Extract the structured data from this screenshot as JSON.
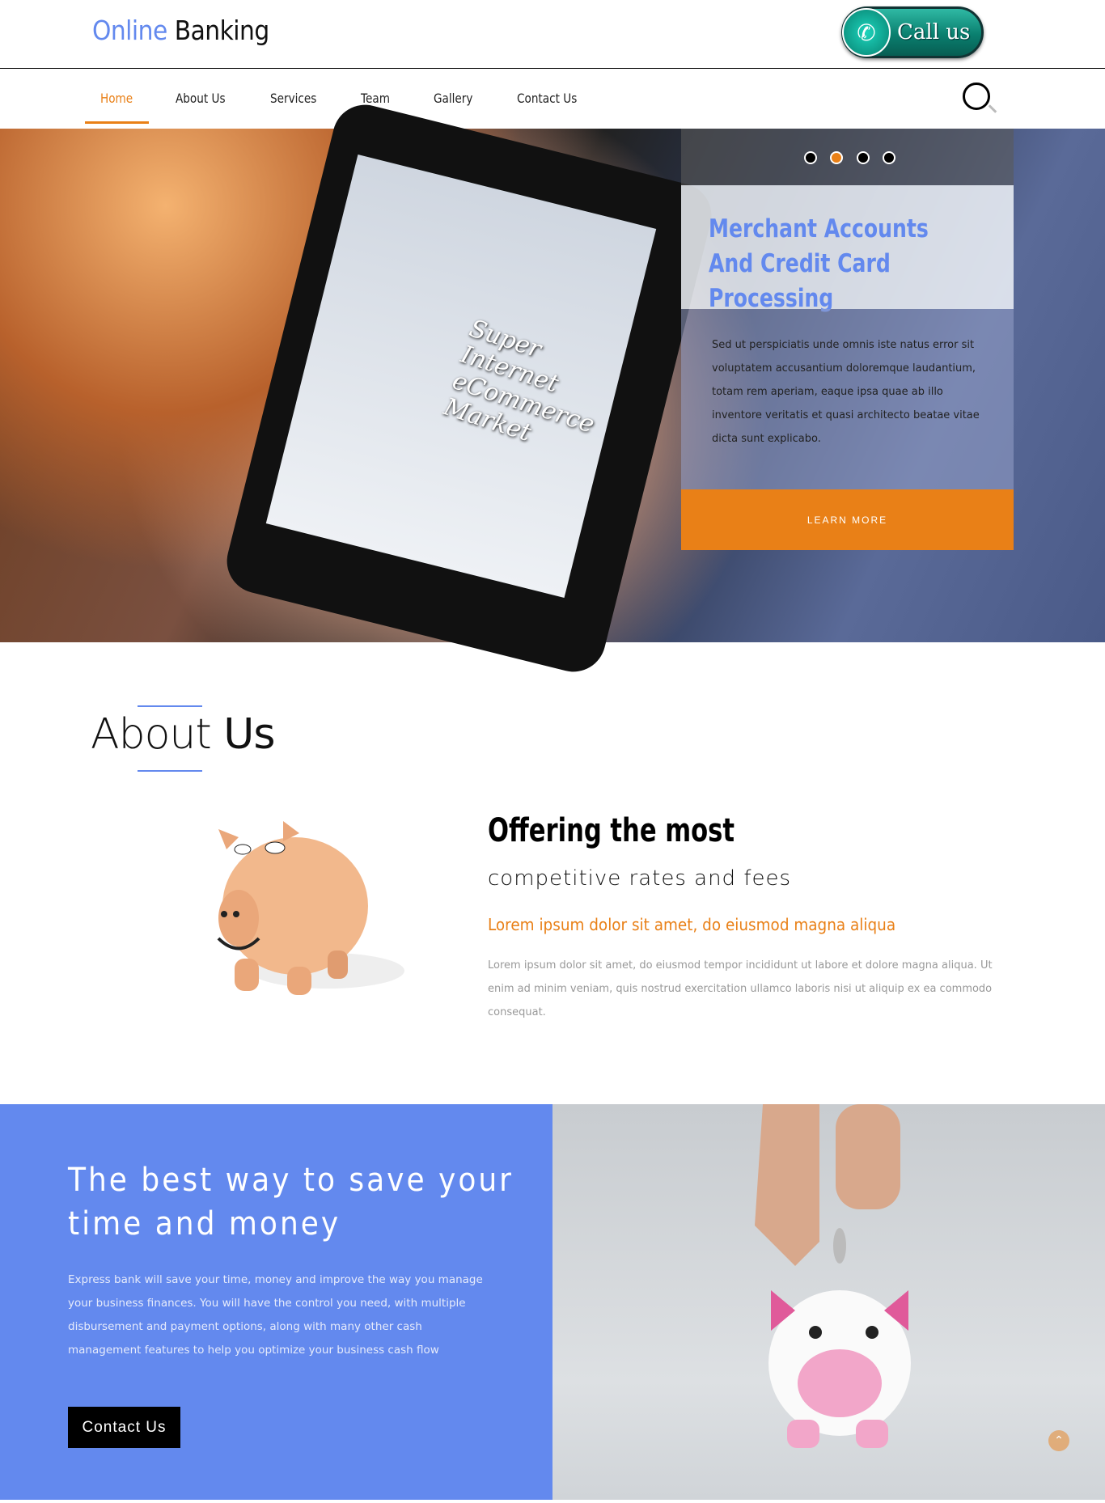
{
  "header": {
    "logo_part1": "Online",
    "logo_part2": "Banking",
    "call_button": "Call us"
  },
  "nav": {
    "items": [
      {
        "label": "Home",
        "active": true
      },
      {
        "label": "About Us"
      },
      {
        "label": "Services"
      },
      {
        "label": "Team"
      },
      {
        "label": "Gallery"
      },
      {
        "label": "Contact Us"
      }
    ]
  },
  "hero": {
    "slide_count": 4,
    "active_slide": 2,
    "title": "Merchant Accounts And Credit Card Processing",
    "phone_text": "Super Internet eCommerce Market",
    "body": "Sed ut perspiciatis unde omnis iste natus error sit voluptatem accusantium doloremque laudantium, totam rem aperiam, eaque ipsa quae ab illo inventore veritatis et quasi architecto beatae vitae dicta sunt explicabo.",
    "button": "LEARN MORE"
  },
  "about": {
    "heading_light": "About",
    "heading_bold": "Us",
    "title": "Offering the most",
    "subtitle": "competitive rates and fees",
    "highlight": "Lorem ipsum dolor sit amet, do eiusmod magna aliqua",
    "body": "Lorem ipsum dolor sit amet, do eiusmod tempor incididunt ut labore et dolore magna aliqua. Ut enim ad minim veniam, quis nostrud exercitation ullamco laboris nisi ut aliquip ex ea commodo consequat."
  },
  "save": {
    "heading": "The best way to save your time and money",
    "body": "Express bank will save your time, money and improve the way you manage your business finances. You will have the control you need, with multiple disbursement and payment options, along with many other cash management features to help you optimize your business cash flow",
    "button": "Contact Us"
  },
  "colors": {
    "accent": "#e98017",
    "brand_blue": "#6389ee"
  }
}
